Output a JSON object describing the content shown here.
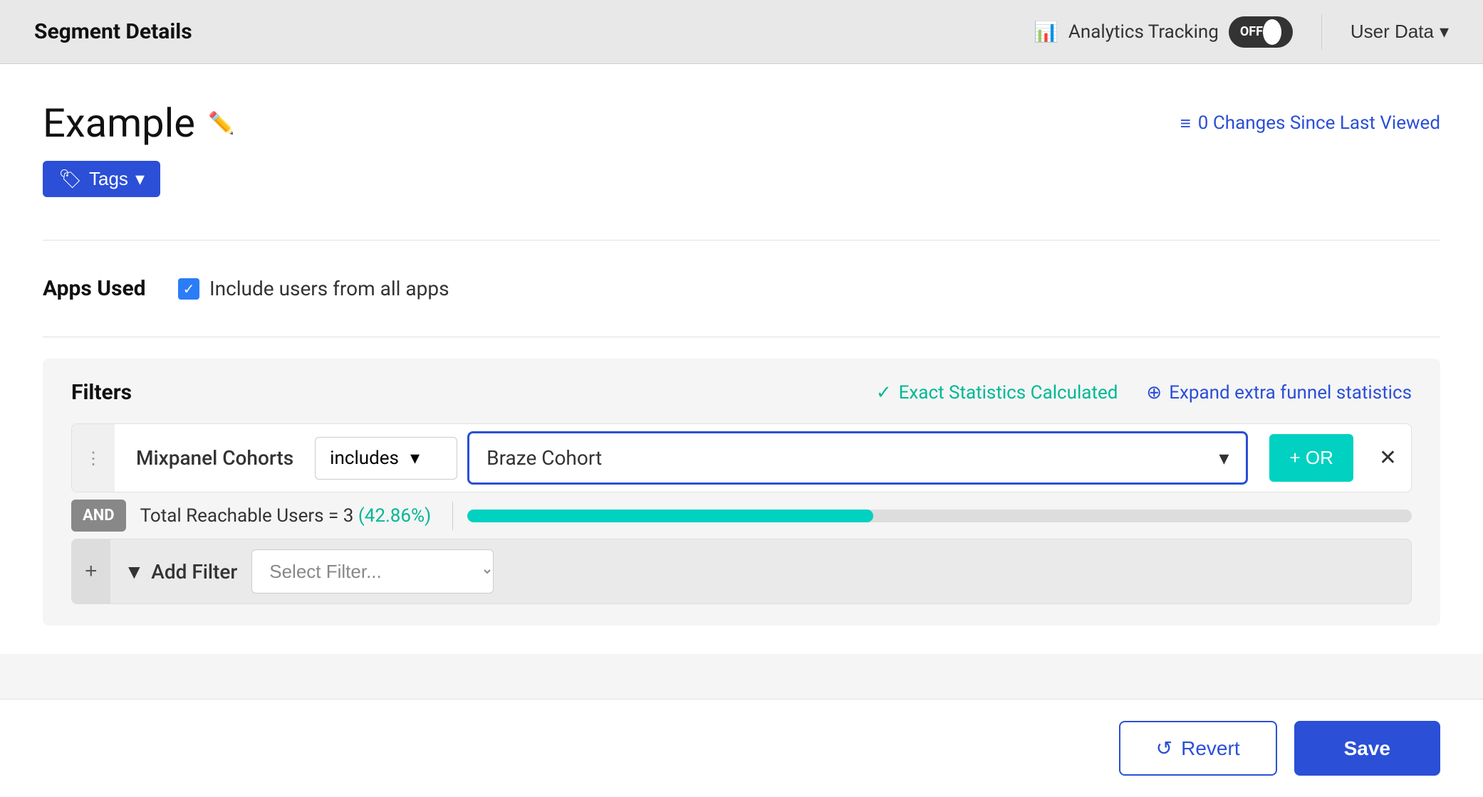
{
  "header": {
    "title": "Segment Details",
    "analytics_label": "Analytics Tracking",
    "toggle_state": "OFF",
    "user_data_label": "User Data"
  },
  "page": {
    "title": "Example",
    "changes_label": "0 Changes Since Last Viewed",
    "tags_button": "Tags"
  },
  "apps_used": {
    "label": "Apps Used",
    "checkbox_label": "Include users from all apps",
    "checked": true
  },
  "filters": {
    "title": "Filters",
    "exact_stats_label": "Exact Statistics Calculated",
    "expand_funnel_label": "Expand extra funnel statistics",
    "filter_rows": [
      {
        "name": "Mixpanel Cohorts",
        "operator": "includes",
        "value": "Braze Cohort"
      }
    ],
    "stats": {
      "label": "Total Reachable Users = 3",
      "percentage": "42.86%",
      "progress": 43
    },
    "and_label": "AND",
    "add_filter_label": "Add Filter",
    "select_filter_placeholder": "Select Filter...",
    "or_button": "+ OR"
  },
  "footer": {
    "revert_label": "Revert",
    "save_label": "Save"
  }
}
